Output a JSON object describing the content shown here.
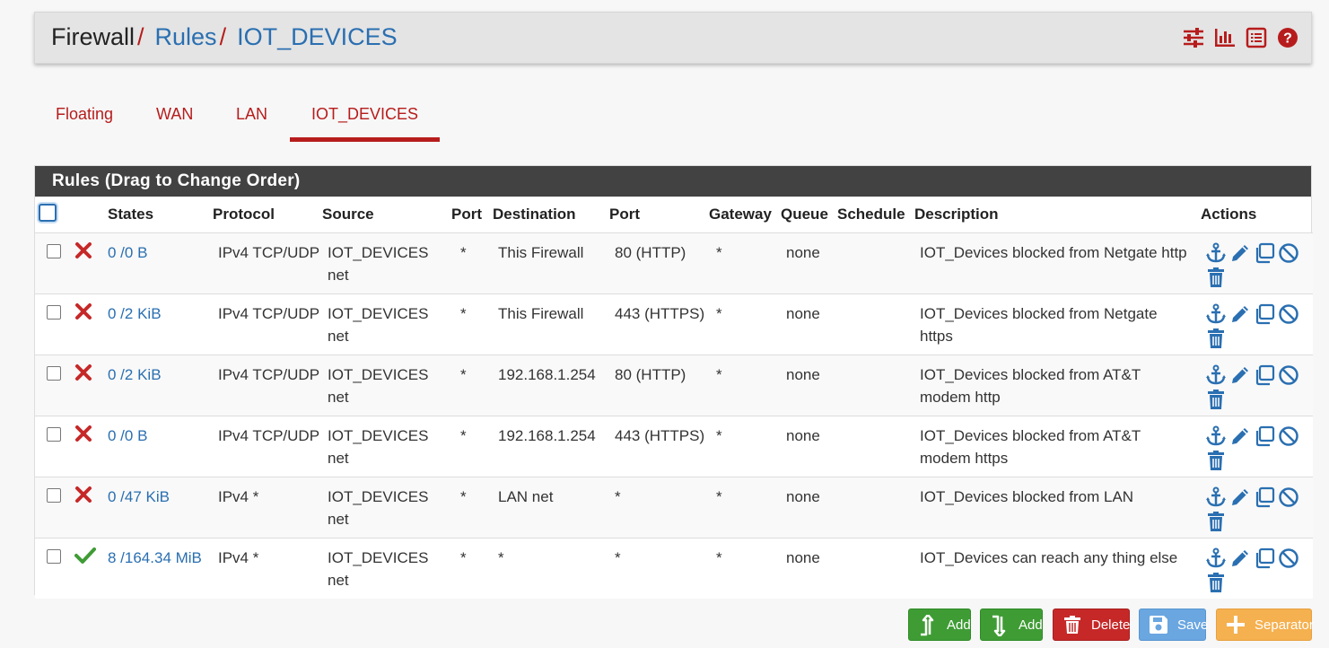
{
  "breadcrumb": {
    "root": "Firewall",
    "sep": "/",
    "rules": "Rules",
    "current": "IOT_DEVICES"
  },
  "header_icons": [
    "sliders-icon",
    "bar-chart-icon",
    "list-icon",
    "help-icon"
  ],
  "tabs": [
    {
      "label": "Floating",
      "active": false
    },
    {
      "label": "WAN",
      "active": false
    },
    {
      "label": "LAN",
      "active": false
    },
    {
      "label": "IOT_DEVICES",
      "active": true
    }
  ],
  "panel": {
    "title": "Rules (Drag to Change Order)"
  },
  "columns": [
    "States",
    "Protocol",
    "Source",
    "Port",
    "Destination",
    "Port",
    "Gateway",
    "Queue",
    "Schedule",
    "Description",
    "Actions"
  ],
  "rows": [
    {
      "status": "block",
      "states": "0 /0 B",
      "protocol": "IPv4 TCP/UDP",
      "source": "IOT_DEVICES net",
      "sport": "*",
      "destination": "This Firewall",
      "dport": "80 (HTTP)",
      "gateway": "*",
      "queue": "none",
      "schedule": "",
      "description": "IOT_Devices blocked from Netgate http"
    },
    {
      "status": "block",
      "states": "0 /2 KiB",
      "protocol": "IPv4 TCP/UDP",
      "source": "IOT_DEVICES net",
      "sport": "*",
      "destination": "This Firewall",
      "dport": "443 (HTTPS)",
      "gateway": "*",
      "queue": "none",
      "schedule": "",
      "description": "IOT_Devices blocked from Netgate https"
    },
    {
      "status": "block",
      "states": "0 /2 KiB",
      "protocol": "IPv4 TCP/UDP",
      "source": "IOT_DEVICES net",
      "sport": "*",
      "destination": "192.168.1.254",
      "dport": "80 (HTTP)",
      "gateway": "*",
      "queue": "none",
      "schedule": "",
      "description": "IOT_Devices blocked from AT&T modem http"
    },
    {
      "status": "block",
      "states": "0 /0 B",
      "protocol": "IPv4 TCP/UDP",
      "source": "IOT_DEVICES net",
      "sport": "*",
      "destination": "192.168.1.254",
      "dport": "443 (HTTPS)",
      "gateway": "*",
      "queue": "none",
      "schedule": "",
      "description": "IOT_Devices blocked from AT&T modem https"
    },
    {
      "status": "block",
      "states": "0 /47 KiB",
      "protocol": "IPv4 *",
      "source": "IOT_DEVICES net",
      "sport": "*",
      "destination": "LAN net",
      "dport": "*",
      "gateway": "*",
      "queue": "none",
      "schedule": "",
      "description": "IOT_Devices blocked from LAN"
    },
    {
      "status": "pass",
      "states": "8 /164.34 MiB",
      "protocol": "IPv4 *",
      "source": "IOT_DEVICES net",
      "sport": "*",
      "destination": "*",
      "dport": "*",
      "gateway": "*",
      "queue": "none",
      "schedule": "",
      "description": "IOT_Devices can reach any thing else"
    }
  ],
  "row_actions": [
    "anchor-icon",
    "pencil-icon",
    "copy-icon",
    "disable-icon",
    "trash-icon"
  ],
  "buttons": {
    "add_top": "Add",
    "add_bottom": "Add",
    "delete": "Delete",
    "save": "Save",
    "separator": "Separator"
  },
  "colors": {
    "accent": "#b71c1c",
    "link": "#2a6fb1",
    "pass": "#3f9c35",
    "block": "#c62828"
  }
}
